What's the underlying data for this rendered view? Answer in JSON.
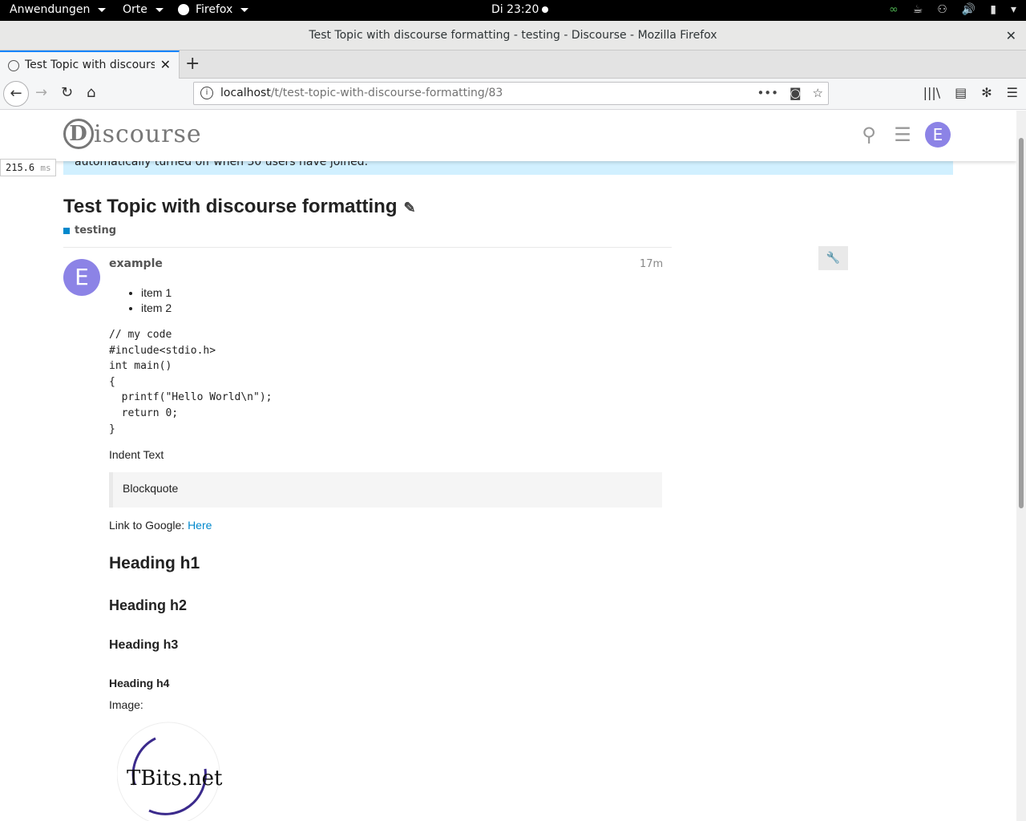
{
  "system_bar": {
    "apps_label": "Anwendungen",
    "places_label": "Orte",
    "firefox_label": "Firefox",
    "clock": "Di 23:20"
  },
  "window": {
    "title": "Test Topic with discourse formatting - testing - Discourse - Mozilla Firefox"
  },
  "tab": {
    "label": "Test Topic with discourse formatting"
  },
  "urlbar": {
    "host": "localhost",
    "path": "/t/test-topic-with-discourse-formatting/83"
  },
  "header": {
    "logo_text": "iscourse",
    "logo_letter": "D",
    "avatar_letter": "E"
  },
  "banner": {
    "text": "automatically turned off when 30 users have joined."
  },
  "profiler": {
    "value": "215.6",
    "unit": "ms"
  },
  "topic": {
    "title": "Test Topic with discourse formatting",
    "category": "testing",
    "category_color": "#0088cc"
  },
  "post": {
    "avatar_letter": "E",
    "avatar_color": "#8c83e6",
    "username": "example",
    "time": "17m",
    "list_items": [
      "item 1",
      "item 2"
    ],
    "code": "// my code\n#include<stdio.h>\nint main()\n{\n  printf(\"Hello World\\n\");\n  return 0;\n}",
    "indent_text": "Indent Text",
    "blockquote": "Blockquote",
    "link_prefix": "Link to Google: ",
    "link_text": "Here",
    "h1": "Heading h1",
    "h2": "Heading h2",
    "h3": "Heading h3",
    "h4": "Heading h4",
    "image_label": "Image:",
    "image_logo_text": "TBits.net"
  },
  "colors": {
    "accent": "#0088cc",
    "banner_bg": "#d1f0ff",
    "avatar": "#8c83e6"
  }
}
